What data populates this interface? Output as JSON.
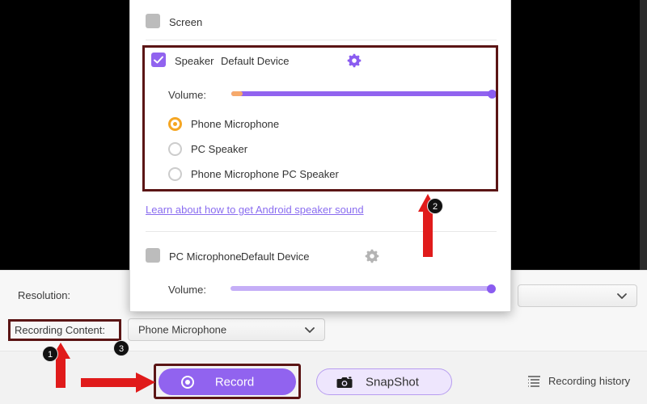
{
  "app": {
    "preview_area": "black-video-preview"
  },
  "popup": {
    "screen_row": {
      "label": "Screen",
      "checked": false
    },
    "speaker_row": {
      "label": "Speaker",
      "device": "Default Device",
      "checked": true,
      "gear_icon": "gear-icon"
    },
    "speaker_volume": {
      "label": "Volume:",
      "value": 100
    },
    "radio_options": [
      {
        "label": "Phone Microphone",
        "selected": true
      },
      {
        "label": "PC Speaker",
        "selected": false
      },
      {
        "label": "Phone Microphone  PC Speaker",
        "selected": false
      }
    ],
    "learn_link": "Learn about how to get Android speaker sound",
    "pc_microphone_row": {
      "label": "PC Microphone",
      "device": "Default Device",
      "checked": false,
      "gear_icon": "gear-icon"
    },
    "pc_mic_volume": {
      "label": "Volume:",
      "value": 100
    }
  },
  "settings": {
    "resolution_label": "Resolution:",
    "resolution_value": "",
    "recording_content_label": "Recording Content:",
    "recording_content_value": "Phone Microphone"
  },
  "actions": {
    "record_label": "Record",
    "snapshot_label": "SnapShot",
    "recording_history_label": "Recording history"
  },
  "annotations": {
    "badges": [
      "1",
      "2",
      "3"
    ],
    "highlight_color": "#5b1515",
    "arrow_color": "#e01b1b"
  },
  "colors": {
    "accent_purple": "#9163ef",
    "light_purple": "#c5aef7",
    "orange": "#f5a623",
    "link_purple": "#8a6df0"
  }
}
